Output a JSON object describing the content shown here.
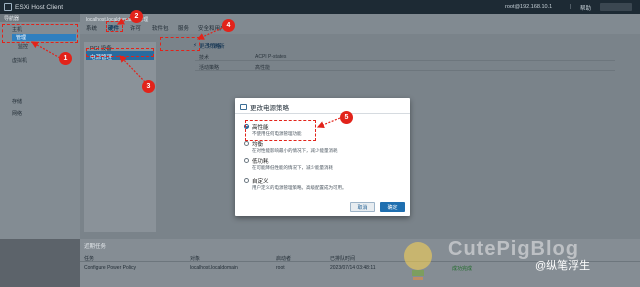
{
  "topbar": {
    "title": "ESXi Host Client",
    "user": "root@192.168.10.1",
    "help": "帮助"
  },
  "navigator": {
    "header": "导航器",
    "items": [
      {
        "label": "主机"
      },
      {
        "label": "管理"
      },
      {
        "label": "监控"
      },
      {
        "label": "虚拟机"
      },
      {
        "label": "存储"
      },
      {
        "label": "网络"
      }
    ]
  },
  "header": {
    "crumb": "localhost.localdomain - 管理",
    "tabs": [
      {
        "label": "系统"
      },
      {
        "label": "硬件"
      },
      {
        "label": "许可"
      },
      {
        "label": "软件包"
      },
      {
        "label": "服务"
      },
      {
        "label": "安全和用户"
      }
    ]
  },
  "subnav": {
    "items": [
      {
        "label": "PCI 设备"
      },
      {
        "label": "电源管理"
      }
    ]
  },
  "toolbar": {
    "change_policy": "更改策略",
    "refresh": "刷新"
  },
  "table": {
    "rows": [
      {
        "key": "技术",
        "value": "ACPI P-states"
      },
      {
        "key": "活动策略",
        "value": "高性能"
      }
    ]
  },
  "dialog": {
    "title": "更改电源策略",
    "options": [
      {
        "name": "高性能",
        "desc": "不使用任何电源管理功能",
        "selected": true
      },
      {
        "name": "均衡",
        "desc": "在对性能影响最小的情况下，减少能量消耗",
        "selected": false
      },
      {
        "name": "低功耗",
        "desc": "在可能降低性能的情况下，减少能量消耗",
        "selected": false
      },
      {
        "name": "自定义",
        "desc": "用户定义的电源管理策略。高级配置成为可用。",
        "selected": false
      }
    ],
    "cancel": "取消",
    "ok": "确定"
  },
  "tasks": {
    "header": "近期任务",
    "columns": [
      "任务",
      "对象",
      "启动者",
      "已排队时间"
    ],
    "rows": [
      {
        "task": "Configure Power Policy",
        "target": "localhost.localdomain",
        "initiator": "root",
        "queued": "2023/07/14 03:48:11",
        "status": "成功完成"
      }
    ]
  },
  "annotations": [
    "1",
    "2",
    "3",
    "4",
    "5"
  ],
  "watermark": {
    "brand": "CutePigBlog",
    "handle": "@纵笔浮生"
  },
  "colors": {
    "accent": "#1f6fb0",
    "annotation": "#e2231a"
  }
}
